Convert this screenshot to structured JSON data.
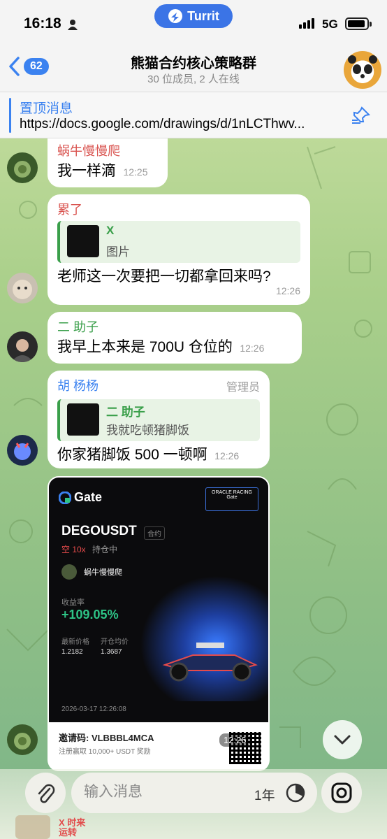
{
  "status_bar": {
    "time": "16:18",
    "app_pill": "Turrit",
    "network": "5G"
  },
  "header": {
    "back_count": "62",
    "title": "熊猫合约核心策略群",
    "subtitle": "30 位成员, 2 人在线"
  },
  "pinned": {
    "title": "置顶消息",
    "text": "https://docs.google.com/drawings/d/1nLCThwv..."
  },
  "messages": [
    {
      "sender": "蜗牛慢慢爬",
      "sender_color": "#d9534f",
      "text": "我一样滴",
      "time": "12:25"
    },
    {
      "sender": "累了",
      "sender_color": "#d9534f",
      "reply_name": "X",
      "reply_text": "图片",
      "text": "老师这一次要把一切都拿回来吗?",
      "time": "12:26"
    },
    {
      "sender": "二 助子",
      "sender_color": "#3a9f4a",
      "text": "我早上本来是 700U 仓位的",
      "time": "12:26"
    },
    {
      "sender": "胡 杨杨",
      "sender_color": "#3b82f0",
      "role": "管理员",
      "reply_name": "二 助子",
      "reply_text": "我就吃顿猪脚饭",
      "text": "你家猪脚饭 500 一顿啊",
      "time": "12:26"
    }
  ],
  "card": {
    "brand": "Gate",
    "oracle_tag": "ORACLE RACING Gate",
    "pair": "DEGOUSDT",
    "contract_tag": "合约",
    "side": "空 10x",
    "state": "持仓中",
    "user": "蜗牛慢慢爬",
    "yield_label": "收益率",
    "yield": "+109.05%",
    "last_price_label": "最新价格",
    "last_price": "1.2182",
    "entry_price_label": "开仓均价",
    "entry_price": "1.3687",
    "timestamp": "2026-03-17 12:26:08",
    "invite": "邀请码: VLBBBL4MCA",
    "bonus": "注册赢取 10,000+ USDT 奖励",
    "time": "12:26"
  },
  "composer": {
    "placeholder": "输入消息",
    "timer_label": "1年",
    "partial_label": "X 时来\n运转"
  }
}
